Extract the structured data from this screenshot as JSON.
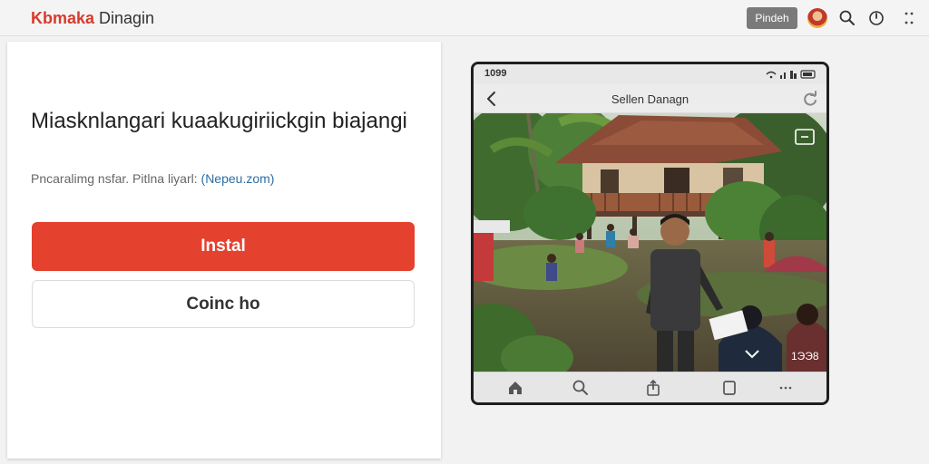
{
  "header": {
    "brand_primary": "Kbmaka",
    "brand_secondary": "Dinagin",
    "button_label": "Pindeh"
  },
  "card": {
    "title": "Miasknlangari kuaakugiriickgin biajangi",
    "subtitle_prefix": "Pncaralimg nsfar. Pitlna liyarl: ",
    "subtitle_link": "(Nepeu.zom)",
    "install_label": "Instal",
    "continue_label": "Coinc ho"
  },
  "phone": {
    "status_time": "1099",
    "nav_title": "Sellen Danagn",
    "photo_counter": "1ЭЭ8"
  },
  "icons": {
    "header": [
      "avatar",
      "search-icon",
      "notification-icon",
      "more-icon"
    ],
    "phone_bottom": [
      "home-icon",
      "search-icon",
      "share-icon",
      "tabs-icon",
      "more-icon"
    ]
  },
  "colors": {
    "brand_red": "#d93a2b",
    "install_red": "#e4412f",
    "link_blue": "#2e6da4",
    "header_button": "#7a7a7a"
  }
}
